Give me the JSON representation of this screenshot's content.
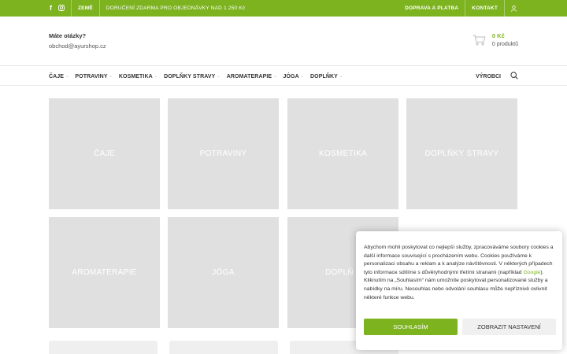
{
  "topbar": {
    "social_facebook": "f",
    "zeme_label": "ZEMĚ",
    "promo": "DORUČENÍ ZDARMA PRO OBJEDNÁVKY NAD 1 250 Kč",
    "shipping_link": "DOPRAVA A PLATBA",
    "contact_link": "KONTAKT",
    "icons": [
      "facebook-icon",
      "instagram-icon",
      "user-icon"
    ]
  },
  "header": {
    "question": "Máte otázky?",
    "email": "obchod@ayurshop.cz",
    "cart_total": "0 Kč",
    "cart_count": "0 produktů"
  },
  "nav": {
    "items": [
      {
        "label": "ČAJE"
      },
      {
        "label": "POTRAVINY"
      },
      {
        "label": "KOSMETIKA"
      },
      {
        "label": "DOPLŇKY STRAVY"
      },
      {
        "label": "AROMATERAPIE"
      },
      {
        "label": "JÓGA"
      },
      {
        "label": "DOPLŇKY"
      }
    ],
    "manufacturers": "VÝROBCI"
  },
  "categories": [
    {
      "label": "ČAJE"
    },
    {
      "label": "POTRAVINY"
    },
    {
      "label": "KOSMETIKA"
    },
    {
      "label": "DOPLŇKY STRAVY"
    },
    {
      "label": "AROMATERAPIE"
    },
    {
      "label": "JÓGA"
    },
    {
      "label": "DOPLŇ"
    }
  ],
  "cookie": {
    "text_before_link": "Abychom mohli poskytovat co nejlepší služby, zpracováváme soubory cookies a další informace související s procházením webu. Cookies používáme k personalizaci obsahu a reklam a k analýze návštěvnosti. V některých případech tyto informace sdílíme s důvěryhodnými třetími stranami (například ",
    "link_text": "Google",
    "text_after_link": "). Kliknutím na „Souhlasím“ nám umožníte poskytovat personalizované služby a nabídky na míru. Nesouhlas nebo odvolání souhlasu může nepříznivě ovlivnit některé funkce webu.",
    "accept_label": "SOUHLASÍM",
    "settings_label": "ZOBRAZIT NASTAVENÍ"
  },
  "colors": {
    "brand_green": "#7db31f",
    "tile_gray": "#e0e0e0"
  }
}
